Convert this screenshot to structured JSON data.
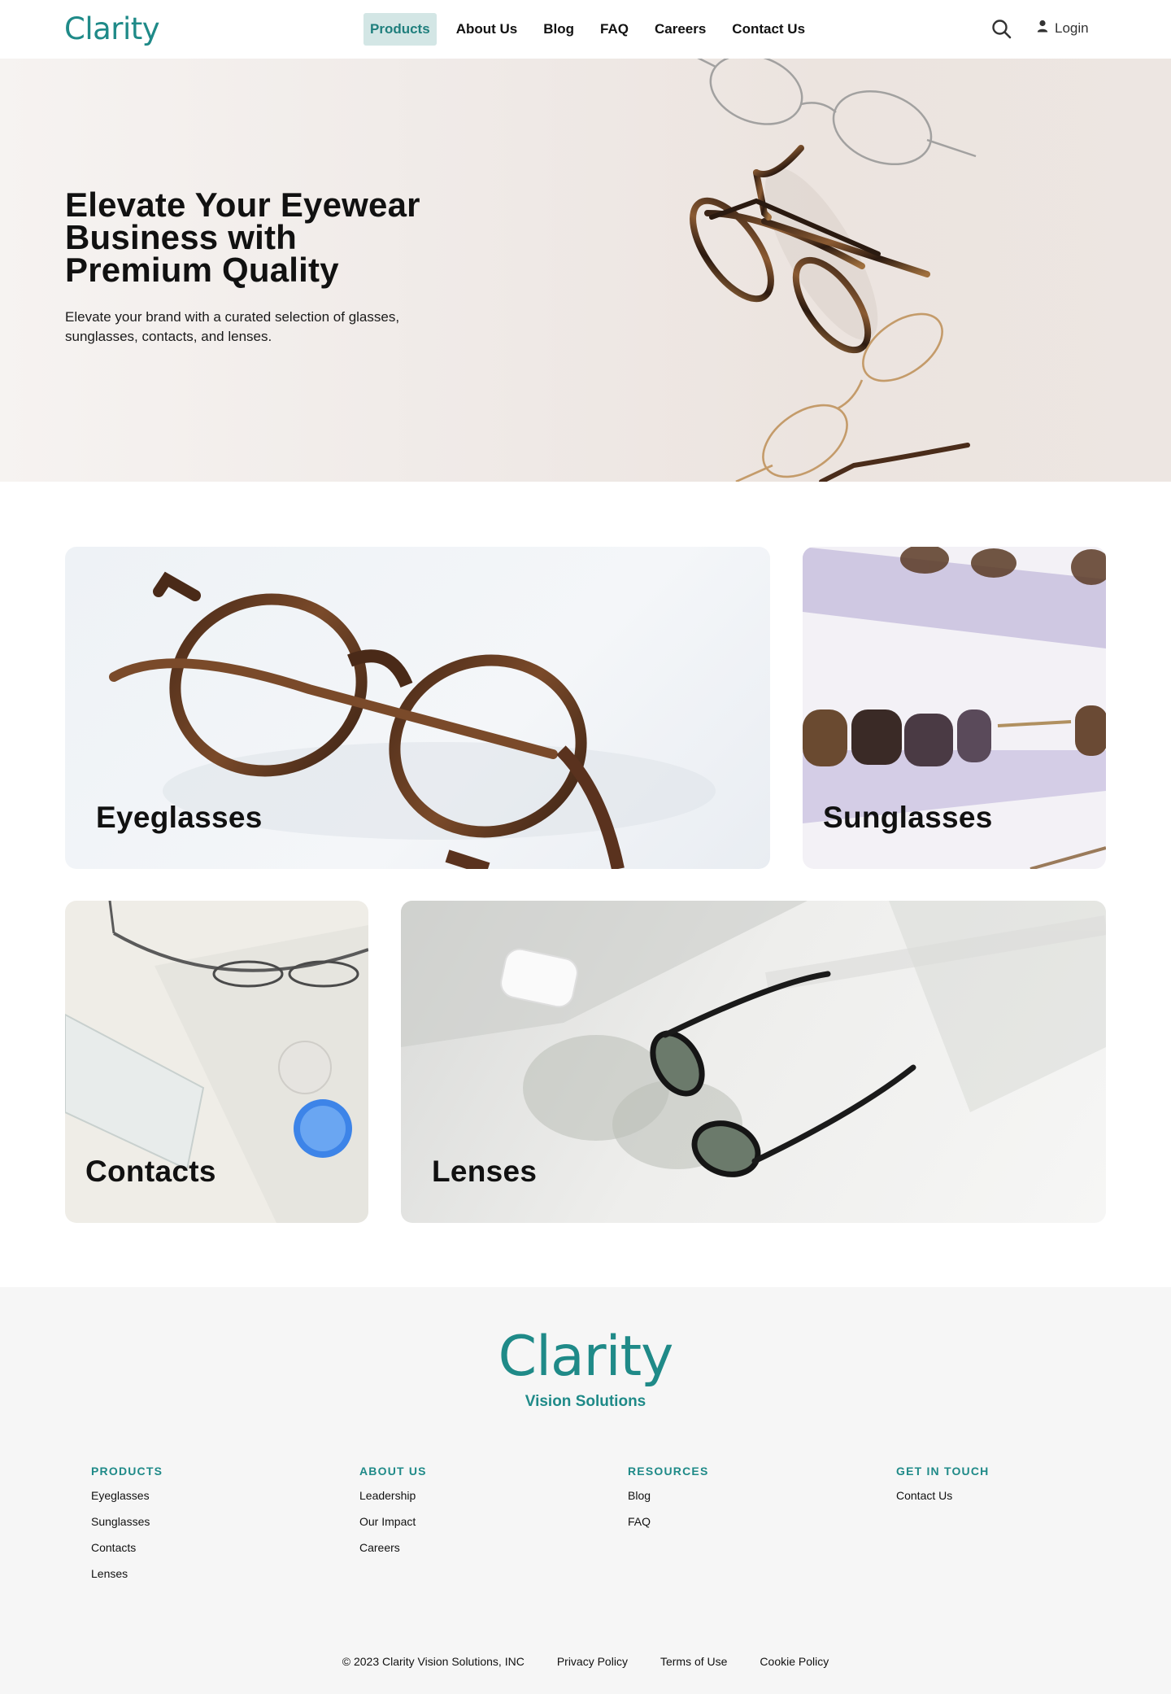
{
  "brand": {
    "name": "Clarity",
    "tagline": "Vision Solutions",
    "accent": "#1f8a88"
  },
  "nav": {
    "items": [
      {
        "label": "Products",
        "active": true
      },
      {
        "label": "About Us",
        "active": false
      },
      {
        "label": "Blog",
        "active": false
      },
      {
        "label": "FAQ",
        "active": false
      },
      {
        "label": "Careers",
        "active": false
      },
      {
        "label": "Contact Us",
        "active": false
      }
    ],
    "search_icon": "search-icon",
    "login_label": "Login",
    "login_icon": "user-icon"
  },
  "hero": {
    "title": "Elevate Your Eyewear Business with Premium Quality",
    "subtitle": "Elevate your brand with a curated selection of glasses, sunglasses, contacts, and lenses."
  },
  "products": [
    {
      "label": "Eyeglasses"
    },
    {
      "label": "Sunglasses"
    },
    {
      "label": "Contacts"
    },
    {
      "label": "Lenses"
    }
  ],
  "footer": {
    "columns": [
      {
        "heading": "PRODUCTS",
        "links": [
          "Eyeglasses",
          "Sunglasses",
          "Contacts",
          "Lenses"
        ]
      },
      {
        "heading": "ABOUT US",
        "links": [
          "Leadership",
          "Our Impact",
          "Careers"
        ]
      },
      {
        "heading": "RESOURCES",
        "links": [
          "Blog",
          "FAQ"
        ]
      },
      {
        "heading": "GET IN TOUCH",
        "links": [
          "Contact Us"
        ]
      }
    ],
    "copyright": "© 2023 Clarity Vision Solutions, INC",
    "legal": [
      "Privacy Policy",
      "Terms of Use",
      "Cookie Policy"
    ]
  }
}
